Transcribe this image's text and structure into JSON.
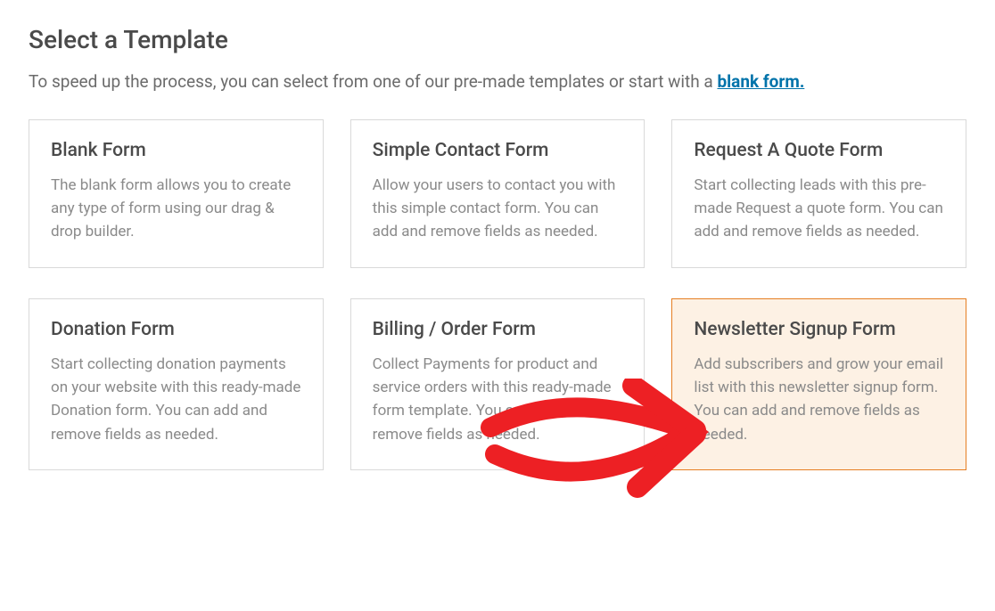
{
  "header": {
    "title": "Select a Template",
    "subtitle_prefix": "To speed up the process, you can select from one of our pre-made templates or start with a ",
    "blank_link_label": "blank form."
  },
  "templates": [
    {
      "title": "Blank Form",
      "desc": "The blank form allows you to create any type of form using our drag & drop builder.",
      "highlighted": false
    },
    {
      "title": "Simple Contact Form",
      "desc": "Allow your users to contact you with this simple contact form. You can add and remove fields as needed.",
      "highlighted": false
    },
    {
      "title": "Request A Quote Form",
      "desc": "Start collecting leads with this pre-made Request a quote form. You can add and remove fields as needed.",
      "highlighted": false
    },
    {
      "title": "Donation Form",
      "desc": "Start collecting donation payments on your website with this ready-made Donation form. You can add and remove fields as needed.",
      "highlighted": false
    },
    {
      "title": "Billing / Order Form",
      "desc": "Collect Payments for product and service orders with this ready-made form template. You can add and remove fields as needed.",
      "highlighted": false
    },
    {
      "title": "Newsletter Signup Form",
      "desc": "Add subscribers and grow your email list with this newsletter signup form. You can add and remove fields as needed.",
      "highlighted": true
    }
  ],
  "annotation": {
    "arrow_color": "#ed2024"
  }
}
